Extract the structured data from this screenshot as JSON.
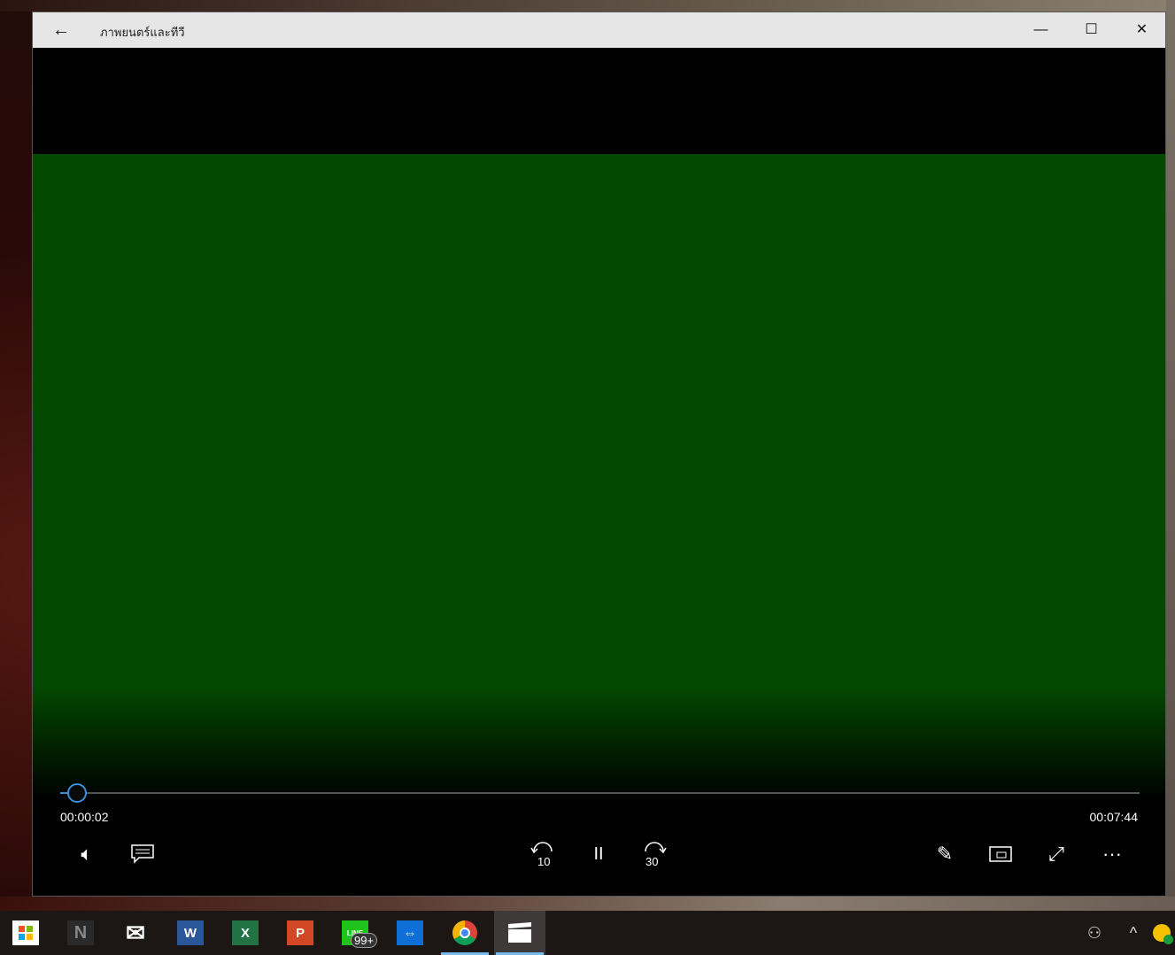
{
  "window": {
    "title": "ภาพยนตร์และทีวี",
    "back_icon": "arrow-left-icon",
    "minimize": "—",
    "maximize": "☐",
    "close": "✕"
  },
  "player": {
    "current_time": "00:00:02",
    "total_time": "00:07:44",
    "progress_fraction": 0.0043,
    "buttons": {
      "volume": "🔈",
      "captions": "▭",
      "skip_back": "10",
      "play_pause": "II",
      "skip_forward": "30",
      "edit": "✎",
      "mini_view": "▣",
      "fullscreen": "⤢",
      "more": "···"
    }
  },
  "video_color": "#034a00",
  "taskbar": {
    "apps": [
      {
        "name": "store",
        "label": ""
      },
      {
        "name": "n-app",
        "label": "N"
      },
      {
        "name": "mail",
        "label": "✉"
      },
      {
        "name": "word",
        "label": "W"
      },
      {
        "name": "excel",
        "label": "X"
      },
      {
        "name": "powerpoint",
        "label": "P"
      },
      {
        "name": "line",
        "label": "LINE",
        "badge": "99+"
      },
      {
        "name": "teamviewer",
        "label": "⇔"
      },
      {
        "name": "chrome",
        "label": ""
      },
      {
        "name": "movies-tv",
        "label": "🎬"
      }
    ],
    "tray": {
      "people": "⚇",
      "chevron": "^"
    }
  }
}
